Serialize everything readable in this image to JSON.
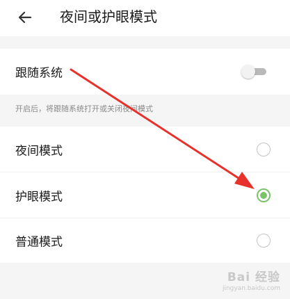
{
  "header": {
    "back_icon": "arrow-left-icon",
    "title": "夜间或护眼模式"
  },
  "follow_system": {
    "label": "跟随系统",
    "toggle_on": false,
    "hint": "开启后，将跟随系统打开或关闭夜间模式"
  },
  "modes": {
    "night": {
      "label": "夜间模式",
      "selected": false
    },
    "eye": {
      "label": "护眼模式",
      "selected": true
    },
    "normal": {
      "label": "普通模式",
      "selected": false
    }
  },
  "colors": {
    "accent": "#7bc36a",
    "annotation_arrow": "#e8312a"
  },
  "watermark": {
    "main": "Bai 经验",
    "sub": "jingyan.baidu.com"
  }
}
